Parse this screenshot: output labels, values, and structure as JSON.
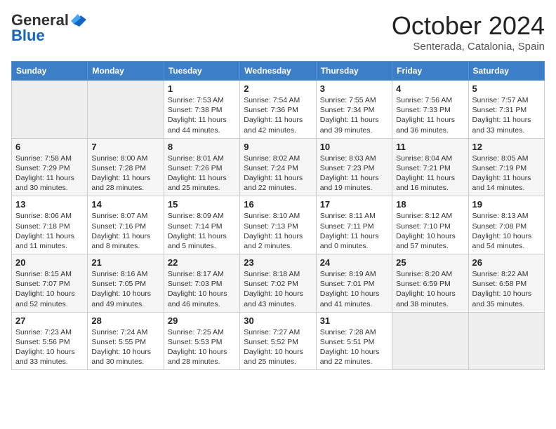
{
  "header": {
    "logo_general": "General",
    "logo_blue": "Blue",
    "month": "October 2024",
    "location": "Senterada, Catalonia, Spain"
  },
  "weekdays": [
    "Sunday",
    "Monday",
    "Tuesday",
    "Wednesday",
    "Thursday",
    "Friday",
    "Saturday"
  ],
  "weeks": [
    [
      {
        "day": "",
        "info": ""
      },
      {
        "day": "",
        "info": ""
      },
      {
        "day": "1",
        "info": "Sunrise: 7:53 AM\nSunset: 7:38 PM\nDaylight: 11 hours and 44 minutes."
      },
      {
        "day": "2",
        "info": "Sunrise: 7:54 AM\nSunset: 7:36 PM\nDaylight: 11 hours and 42 minutes."
      },
      {
        "day": "3",
        "info": "Sunrise: 7:55 AM\nSunset: 7:34 PM\nDaylight: 11 hours and 39 minutes."
      },
      {
        "day": "4",
        "info": "Sunrise: 7:56 AM\nSunset: 7:33 PM\nDaylight: 11 hours and 36 minutes."
      },
      {
        "day": "5",
        "info": "Sunrise: 7:57 AM\nSunset: 7:31 PM\nDaylight: 11 hours and 33 minutes."
      }
    ],
    [
      {
        "day": "6",
        "info": "Sunrise: 7:58 AM\nSunset: 7:29 PM\nDaylight: 11 hours and 30 minutes."
      },
      {
        "day": "7",
        "info": "Sunrise: 8:00 AM\nSunset: 7:28 PM\nDaylight: 11 hours and 28 minutes."
      },
      {
        "day": "8",
        "info": "Sunrise: 8:01 AM\nSunset: 7:26 PM\nDaylight: 11 hours and 25 minutes."
      },
      {
        "day": "9",
        "info": "Sunrise: 8:02 AM\nSunset: 7:24 PM\nDaylight: 11 hours and 22 minutes."
      },
      {
        "day": "10",
        "info": "Sunrise: 8:03 AM\nSunset: 7:23 PM\nDaylight: 11 hours and 19 minutes."
      },
      {
        "day": "11",
        "info": "Sunrise: 8:04 AM\nSunset: 7:21 PM\nDaylight: 11 hours and 16 minutes."
      },
      {
        "day": "12",
        "info": "Sunrise: 8:05 AM\nSunset: 7:19 PM\nDaylight: 11 hours and 14 minutes."
      }
    ],
    [
      {
        "day": "13",
        "info": "Sunrise: 8:06 AM\nSunset: 7:18 PM\nDaylight: 11 hours and 11 minutes."
      },
      {
        "day": "14",
        "info": "Sunrise: 8:07 AM\nSunset: 7:16 PM\nDaylight: 11 hours and 8 minutes."
      },
      {
        "day": "15",
        "info": "Sunrise: 8:09 AM\nSunset: 7:14 PM\nDaylight: 11 hours and 5 minutes."
      },
      {
        "day": "16",
        "info": "Sunrise: 8:10 AM\nSunset: 7:13 PM\nDaylight: 11 hours and 2 minutes."
      },
      {
        "day": "17",
        "info": "Sunrise: 8:11 AM\nSunset: 7:11 PM\nDaylight: 11 hours and 0 minutes."
      },
      {
        "day": "18",
        "info": "Sunrise: 8:12 AM\nSunset: 7:10 PM\nDaylight: 10 hours and 57 minutes."
      },
      {
        "day": "19",
        "info": "Sunrise: 8:13 AM\nSunset: 7:08 PM\nDaylight: 10 hours and 54 minutes."
      }
    ],
    [
      {
        "day": "20",
        "info": "Sunrise: 8:15 AM\nSunset: 7:07 PM\nDaylight: 10 hours and 52 minutes."
      },
      {
        "day": "21",
        "info": "Sunrise: 8:16 AM\nSunset: 7:05 PM\nDaylight: 10 hours and 49 minutes."
      },
      {
        "day": "22",
        "info": "Sunrise: 8:17 AM\nSunset: 7:03 PM\nDaylight: 10 hours and 46 minutes."
      },
      {
        "day": "23",
        "info": "Sunrise: 8:18 AM\nSunset: 7:02 PM\nDaylight: 10 hours and 43 minutes."
      },
      {
        "day": "24",
        "info": "Sunrise: 8:19 AM\nSunset: 7:01 PM\nDaylight: 10 hours and 41 minutes."
      },
      {
        "day": "25",
        "info": "Sunrise: 8:20 AM\nSunset: 6:59 PM\nDaylight: 10 hours and 38 minutes."
      },
      {
        "day": "26",
        "info": "Sunrise: 8:22 AM\nSunset: 6:58 PM\nDaylight: 10 hours and 35 minutes."
      }
    ],
    [
      {
        "day": "27",
        "info": "Sunrise: 7:23 AM\nSunset: 5:56 PM\nDaylight: 10 hours and 33 minutes."
      },
      {
        "day": "28",
        "info": "Sunrise: 7:24 AM\nSunset: 5:55 PM\nDaylight: 10 hours and 30 minutes."
      },
      {
        "day": "29",
        "info": "Sunrise: 7:25 AM\nSunset: 5:53 PM\nDaylight: 10 hours and 28 minutes."
      },
      {
        "day": "30",
        "info": "Sunrise: 7:27 AM\nSunset: 5:52 PM\nDaylight: 10 hours and 25 minutes."
      },
      {
        "day": "31",
        "info": "Sunrise: 7:28 AM\nSunset: 5:51 PM\nDaylight: 10 hours and 22 minutes."
      },
      {
        "day": "",
        "info": ""
      },
      {
        "day": "",
        "info": ""
      }
    ]
  ]
}
